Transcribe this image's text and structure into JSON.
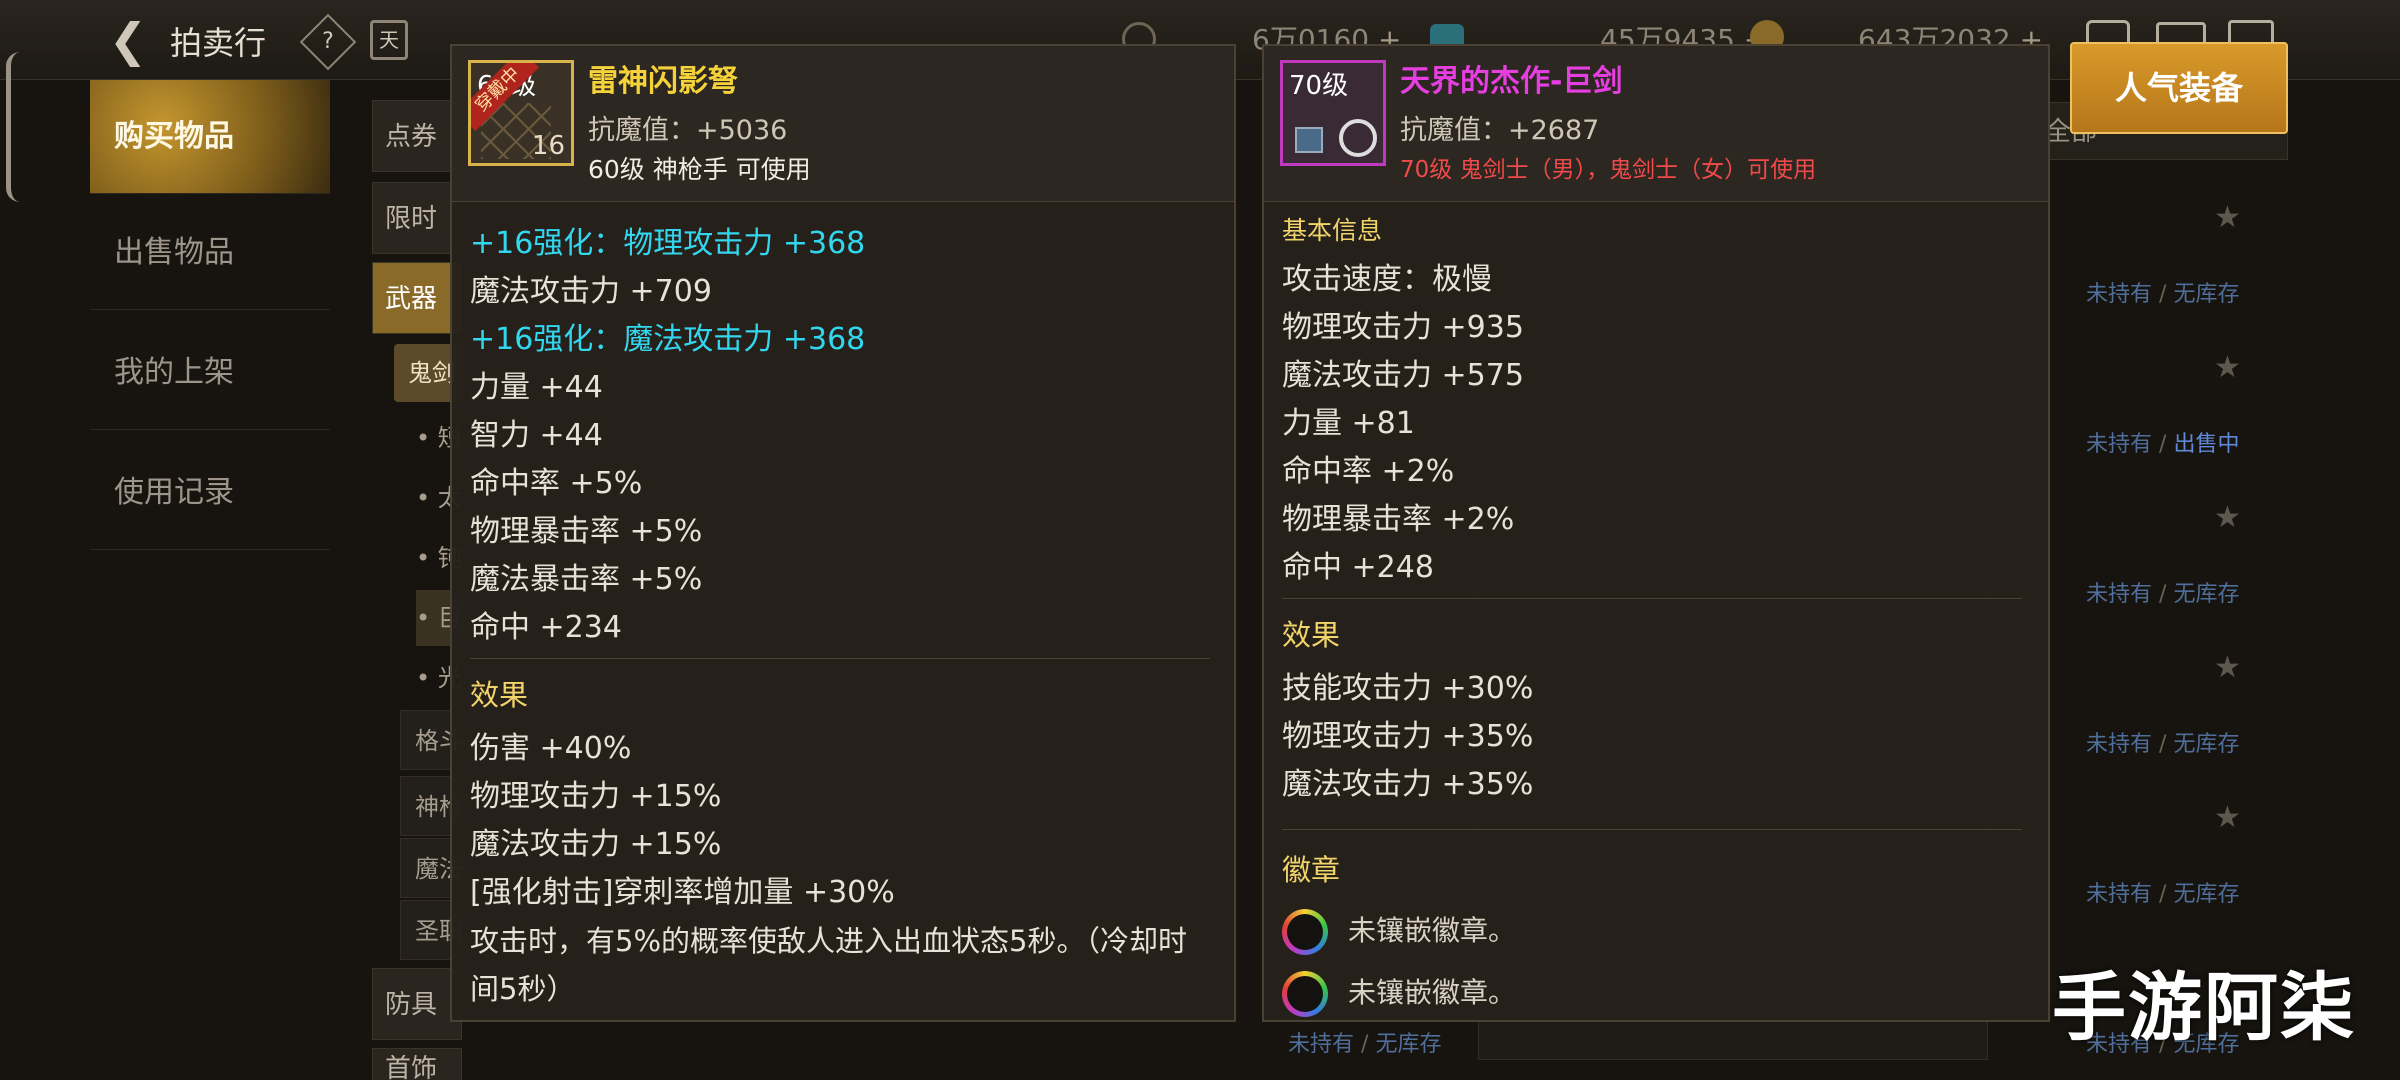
{
  "header": {
    "title": "拍卖行",
    "help_symbol": "?",
    "calendar_symbol": "天",
    "currencies": [
      {
        "icon": "gold-coin-icon",
        "value": "6万0160",
        "plus": "+"
      },
      {
        "icon": "blue-crystal-icon",
        "value": "45万9435",
        "plus": "+"
      },
      {
        "icon": "medal-coin-icon",
        "value": "643万2032",
        "plus": "+"
      }
    ]
  },
  "side_menu": {
    "items": [
      {
        "label": "购买物品",
        "active": true
      },
      {
        "label": "出售物品"
      },
      {
        "label": "我的上架"
      },
      {
        "label": "使用记录"
      }
    ]
  },
  "categories": {
    "coupon": "点券",
    "limited": "限时",
    "weapon": "武器",
    "ghost_sub": "鬼剑",
    "sub_items": [
      "• 短",
      "• 太",
      "• 钝",
      "• 巨",
      "• 光"
    ],
    "other_classes": [
      "格斗",
      "神枪",
      "魔法",
      "圣职"
    ],
    "armor": "防具",
    "accessory": "首饰"
  },
  "filter": {
    "label": "全部"
  },
  "popular_button": "人气装备",
  "listing_status": {
    "not_owned": "未持有",
    "no_stock": "无库存",
    "on_sale": "出售中",
    "separator": "/",
    "star": "★"
  },
  "item_left": {
    "level_badge": "60级",
    "equipped_badge": "穿戴中",
    "enhance": "16",
    "name": "雷神闪影弩",
    "name_color": "#f5d23a",
    "magic_resist": "抗魔值：+5036",
    "requirement": "60级 神枪手 可使用",
    "stats": [
      {
        "text": "+16强化：物理攻击力 +368",
        "highlight": true
      },
      {
        "text": "魔法攻击力 +709"
      },
      {
        "text": "+16强化：魔法攻击力 +368",
        "highlight": true
      },
      {
        "text": "力量 +44"
      },
      {
        "text": "智力 +44"
      },
      {
        "text": "命中率 +5%"
      },
      {
        "text": "物理暴击率 +5%"
      },
      {
        "text": "魔法暴击率 +5%"
      },
      {
        "text": "命中 +234"
      }
    ],
    "effect_title": "效果",
    "effects": [
      "伤害 +40%",
      "物理攻击力 +15%",
      "魔法攻击力 +15%",
      "[强化射击]穿刺率增加量 +30%"
    ],
    "effect_note": "攻击时，有5%的概率使敌人进入出血状态5秒。（冷却时间5秒）"
  },
  "item_right": {
    "level_badge": "70级",
    "name": "天界的杰作-巨剑",
    "name_color": "#e63ee0",
    "magic_resist": "抗魔值：+2687",
    "requirement": "70级 鬼剑士（男），鬼剑士（女）可使用",
    "requirement_color": "#f04a4a",
    "basic_title": "基本信息",
    "stats": [
      "攻击速度：极慢",
      "物理攻击力 +935",
      "魔法攻击力 +575",
      "力量 +81",
      "命中率 +2%",
      "物理暴击率 +2%",
      "命中 +248"
    ],
    "effect_title": "效果",
    "effects": [
      "技能攻击力 +30%",
      "物理攻击力 +35%",
      "魔法攻击力 +35%"
    ],
    "emblem_title": "徽章",
    "emblems": [
      "未镶嵌徽章。",
      "未镶嵌徽章。"
    ]
  },
  "watermark": "手游阿柒"
}
